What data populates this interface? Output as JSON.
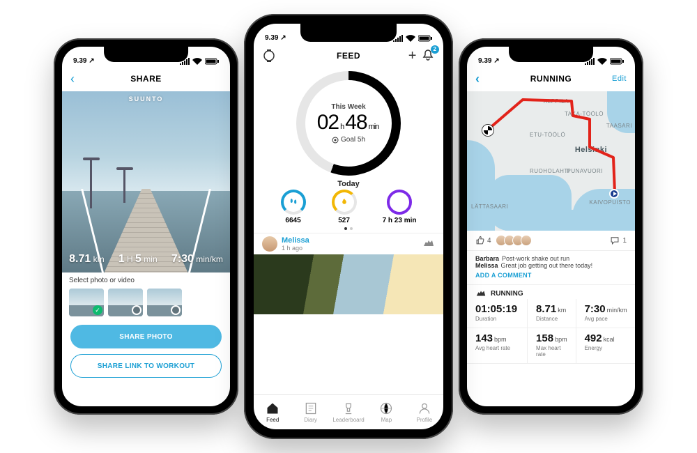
{
  "statusbar": {
    "time": "9.39 ↗"
  },
  "share": {
    "title": "SHARE",
    "brand": "SUUNTO",
    "metrics": {
      "distance_val": "8.71",
      "distance_unit": "km",
      "duration_val": "1",
      "duration_h_unit": "H",
      "duration_min_val": "5",
      "duration_min_unit": "min",
      "pace_val": "7:30",
      "pace_unit": "min/km"
    },
    "select_label": "Select photo or video",
    "btn_primary": "SHARE PHOTO",
    "btn_outline": "SHARE LINK TO WORKOUT"
  },
  "feed": {
    "title": "FEED",
    "bell_badge": "2",
    "this_week_label": "This Week",
    "time_h_val": "02",
    "time_h_unit": "h",
    "time_m_val": "48",
    "time_m_unit": "min",
    "goal_label": "Goal 5h",
    "today_label": "Today",
    "mini": {
      "steps": "6645",
      "steps_color": "#1a9fd4",
      "cal": "527",
      "cal_color": "#f2b705",
      "sleep": "7 h 23 min",
      "sleep_color": "#7d2ae8"
    },
    "post": {
      "name": "Melissa",
      "time": "1 h ago"
    },
    "tabs": [
      "Feed",
      "Diary",
      "Leaderboard",
      "Map",
      "Profile"
    ]
  },
  "run": {
    "title": "RUNNING",
    "edit": "Edit",
    "map_labels": {
      "city": "Helsinki",
      "a": "ALPPILA",
      "b": "TAKA-TÖÖLÖ",
      "c": "ETU-TÖÖLÖ",
      "d": "RUOHOLAHTI",
      "e": "PUNAVUORI",
      "f": "KAIVOPUISTO",
      "g": "TAASARI",
      "h": "LÄTTASAARI"
    },
    "likes": "4",
    "comments_n": "1",
    "comments": [
      {
        "who": "Barbara",
        "text": "Post-work shake out run"
      },
      {
        "who": "Melissa",
        "text": "Great job getting out there today!"
      }
    ],
    "add_comment": "ADD A COMMENT",
    "activity": "RUNNING",
    "stats": {
      "duration": {
        "v": "01:05:19",
        "u": "",
        "l": "Duration"
      },
      "distance": {
        "v": "8.71",
        "u": "km",
        "l": "Distance"
      },
      "pace": {
        "v": "7:30",
        "u": "min/km",
        "l": "Avg pace"
      },
      "avghr": {
        "v": "143",
        "u": "bpm",
        "l": "Avg heart rate"
      },
      "maxhr": {
        "v": "158",
        "u": "bpm",
        "l": "Max heart rate"
      },
      "energy": {
        "v": "492",
        "u": "kcal",
        "l": "Energy"
      }
    }
  }
}
